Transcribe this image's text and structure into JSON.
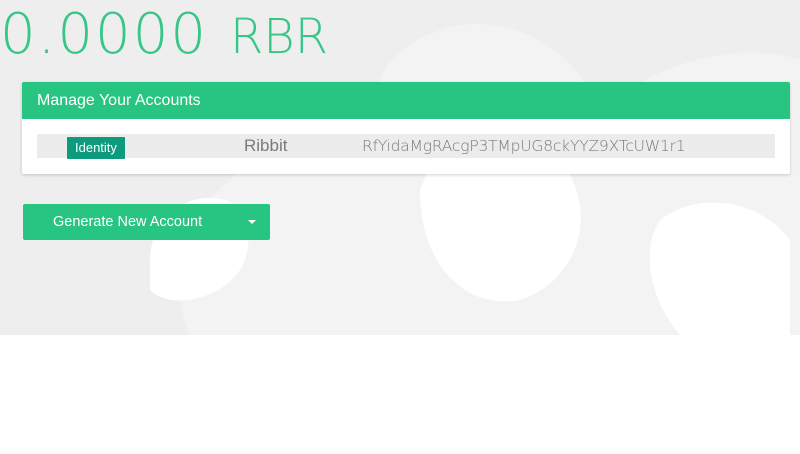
{
  "balance": {
    "amount": "0.0000",
    "unit": "RBR"
  },
  "accounts_panel": {
    "title": "Manage Your Accounts",
    "accounts": [
      {
        "badge": "Identity",
        "name": "Ribbit",
        "address": "RfYidaMgRAcgP3TMpUG8ckYYZ9XTcUW1r1"
      }
    ]
  },
  "actions": {
    "generate_label": "Generate New Account"
  },
  "colors": {
    "accent": "#28c481",
    "badge": "#0e9a7c",
    "row_bg": "#ececec",
    "text_muted": "#7a7a7a",
    "page_bg_art": "#f3f3f3"
  },
  "icons": {
    "dropdown": "caret-down-icon"
  }
}
